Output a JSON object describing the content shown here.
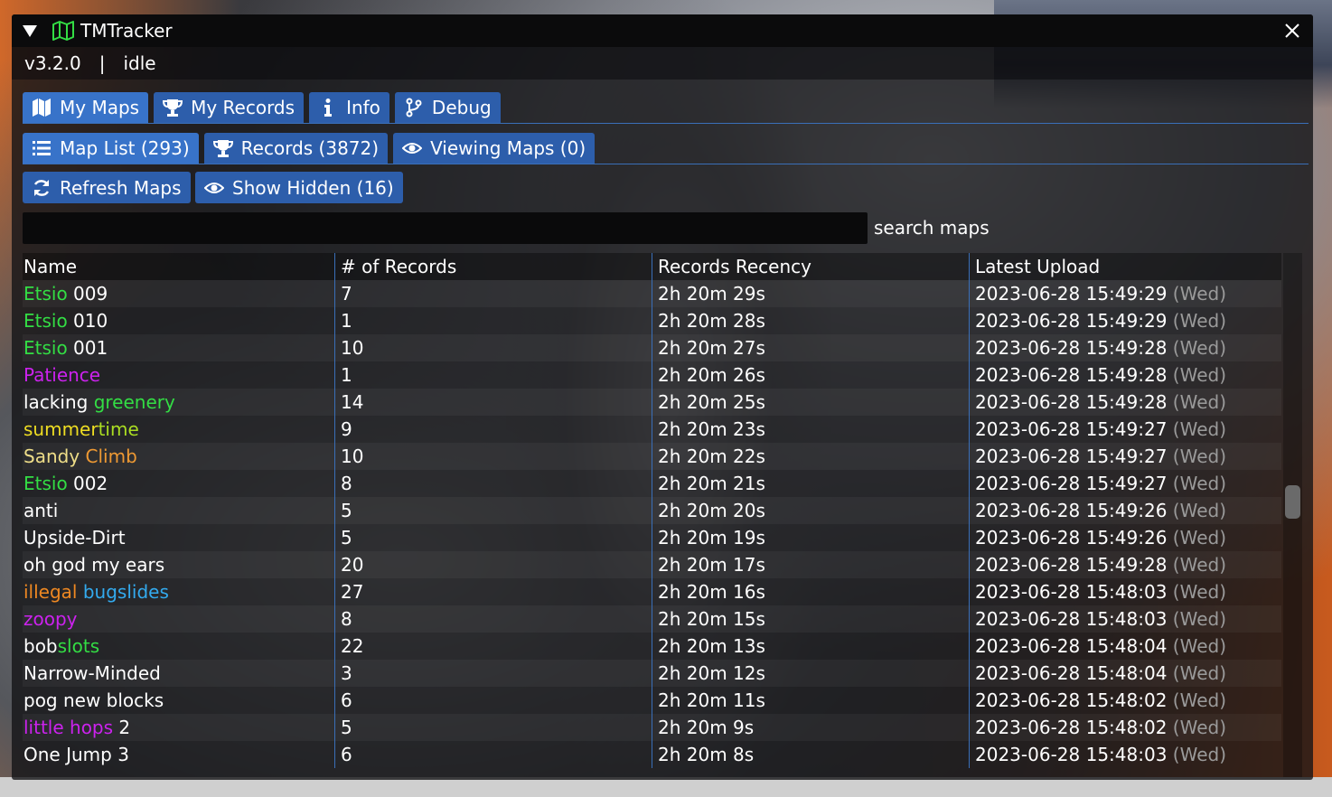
{
  "window": {
    "title": "TMTracker",
    "version": "v3.2.0",
    "separator": "|",
    "state": "idle"
  },
  "main_tabs": [
    {
      "label": "My Maps",
      "icon": "map-icon",
      "active": true
    },
    {
      "label": "My Records",
      "icon": "trophy-icon",
      "active": false
    },
    {
      "label": "Info",
      "icon": "info-icon",
      "active": false
    },
    {
      "label": "Debug",
      "icon": "debug-icon",
      "active": false
    }
  ],
  "sub_tabs": [
    {
      "label": "Map List (293)",
      "icon": "list-icon",
      "active": true
    },
    {
      "label": "Records (3872)",
      "icon": "trophy-icon",
      "active": false
    },
    {
      "label": "Viewing Maps (0)",
      "icon": "eye-icon",
      "active": false
    }
  ],
  "actions": {
    "refresh_label": "Refresh Maps",
    "show_hidden_label": "Show Hidden (16)"
  },
  "search": {
    "value": "",
    "label": "search maps"
  },
  "table": {
    "headers": [
      "Name",
      "# of Records",
      "Records Recency",
      "Latest Upload"
    ],
    "rows": [
      {
        "name": [
          {
            "t": "Etsio",
            "c": "#33dd44"
          },
          {
            "t": " 009",
            "c": "#ffffff"
          }
        ],
        "records": "7",
        "recency": "2h 20m 29s",
        "upload": "2023-06-28 15:49:29",
        "day": "(Wed)"
      },
      {
        "name": [
          {
            "t": "Etsio",
            "c": "#33dd44"
          },
          {
            "t": " 010",
            "c": "#ffffff"
          }
        ],
        "records": "1",
        "recency": "2h 20m 28s",
        "upload": "2023-06-28 15:49:29",
        "day": "(Wed)"
      },
      {
        "name": [
          {
            "t": "Etsio",
            "c": "#33dd44"
          },
          {
            "t": " 001",
            "c": "#ffffff"
          }
        ],
        "records": "10",
        "recency": "2h 20m 27s",
        "upload": "2023-06-28 15:49:28",
        "day": "(Wed)"
      },
      {
        "name": [
          {
            "t": "Patience",
            "c": "#cc22ee"
          }
        ],
        "records": "1",
        "recency": "2h 20m 26s",
        "upload": "2023-06-28 15:49:28",
        "day": "(Wed)"
      },
      {
        "name": [
          {
            "t": "lacking ",
            "c": "#ffffff"
          },
          {
            "t": "greenery",
            "c": "#33dd44"
          }
        ],
        "records": "14",
        "recency": "2h 20m 25s",
        "upload": "2023-06-28 15:49:28",
        "day": "(Wed)"
      },
      {
        "name": [
          {
            "t": "summer",
            "c": "#eedd22"
          },
          {
            "t": "time",
            "c": "#aadd22"
          }
        ],
        "records": "9",
        "recency": "2h 20m 23s",
        "upload": "2023-06-28 15:49:27",
        "day": "(Wed)"
      },
      {
        "name": [
          {
            "t": "Sandy ",
            "c": "#eedd88"
          },
          {
            "t": "Climb",
            "c": "#ee9933"
          }
        ],
        "records": "10",
        "recency": "2h 20m 22s",
        "upload": "2023-06-28 15:49:27",
        "day": "(Wed)"
      },
      {
        "name": [
          {
            "t": "Etsio",
            "c": "#33dd44"
          },
          {
            "t": " 002",
            "c": "#ffffff"
          }
        ],
        "records": "8",
        "recency": "2h 20m 21s",
        "upload": "2023-06-28 15:49:27",
        "day": "(Wed)"
      },
      {
        "name": [
          {
            "t": "anti",
            "c": "#ffffff"
          }
        ],
        "records": "5",
        "recency": "2h 20m 20s",
        "upload": "2023-06-28 15:49:26",
        "day": "(Wed)"
      },
      {
        "name": [
          {
            "t": "Upside-Dirt",
            "c": "#ffffff"
          }
        ],
        "records": "5",
        "recency": "2h 20m 19s",
        "upload": "2023-06-28 15:49:26",
        "day": "(Wed)"
      },
      {
        "name": [
          {
            "t": "oh god my ears",
            "c": "#ffffff"
          }
        ],
        "records": "20",
        "recency": "2h 20m 17s",
        "upload": "2023-06-28 15:49:28",
        "day": "(Wed)"
      },
      {
        "name": [
          {
            "t": "illegal ",
            "c": "#ee8822"
          },
          {
            "t": "bugslides",
            "c": "#33aaee"
          }
        ],
        "records": "27",
        "recency": "2h 20m 16s",
        "upload": "2023-06-28 15:48:03",
        "day": "(Wed)"
      },
      {
        "name": [
          {
            "t": "zoopy",
            "c": "#cc22ee"
          }
        ],
        "records": "8",
        "recency": "2h 20m 15s",
        "upload": "2023-06-28 15:48:03",
        "day": "(Wed)"
      },
      {
        "name": [
          {
            "t": "bob",
            "c": "#ffffff"
          },
          {
            "t": "slots",
            "c": "#33dd44"
          }
        ],
        "records": "22",
        "recency": "2h 20m 13s",
        "upload": "2023-06-28 15:48:04",
        "day": "(Wed)"
      },
      {
        "name": [
          {
            "t": "Narrow-Minded",
            "c": "#ffffff"
          }
        ],
        "records": "3",
        "recency": "2h 20m 12s",
        "upload": "2023-06-28 15:48:04",
        "day": "(Wed)"
      },
      {
        "name": [
          {
            "t": "pog new blocks",
            "c": "#ffffff"
          }
        ],
        "records": "6",
        "recency": "2h 20m 11s",
        "upload": "2023-06-28 15:48:02",
        "day": "(Wed)"
      },
      {
        "name": [
          {
            "t": "little hops",
            "c": "#cc22ee"
          },
          {
            "t": " 2",
            "c": "#ffffff"
          }
        ],
        "records": "5",
        "recency": "2h 20m 9s",
        "upload": "2023-06-28 15:48:02",
        "day": "(Wed)"
      },
      {
        "name": [
          {
            "t": "One Jump 3",
            "c": "#ffffff"
          }
        ],
        "records": "6",
        "recency": "2h 20m 8s",
        "upload": "2023-06-28 15:48:03",
        "day": "(Wed)"
      }
    ]
  }
}
